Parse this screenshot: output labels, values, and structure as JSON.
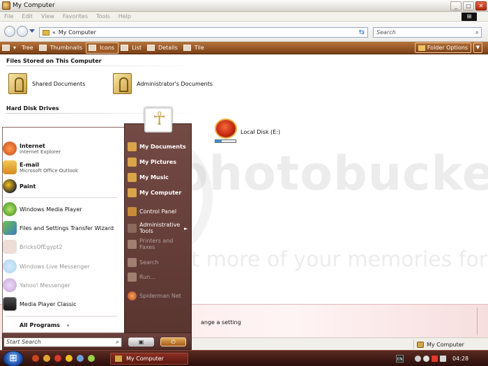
{
  "window": {
    "title": "My Computer",
    "controls": {
      "minimize": "_",
      "maximize": "□",
      "close": "✕"
    }
  },
  "menubar": {
    "items": [
      "File",
      "Edit",
      "View",
      "Favorites",
      "Tools",
      "Help"
    ]
  },
  "addressbar": {
    "chevron": "«",
    "path": "My Computer",
    "search_placeholder": "Search"
  },
  "toolbar": {
    "views": [
      "Tree",
      "Thumbnails",
      "Icons",
      "List",
      "Details",
      "Tile"
    ],
    "active_view": "Icons",
    "folder_options": "Folder Options"
  },
  "content": {
    "groups": [
      {
        "header": "Files Stored on This Computer",
        "items": [
          "Shared Documents",
          "Administrator's Documents"
        ]
      },
      {
        "header": "Hard Disk Drives",
        "items": [
          "Local Disk (E:)"
        ]
      }
    ],
    "drive_fill_percent": 30
  },
  "details_pane": {
    "text": "ange a setting"
  },
  "statusbar": {
    "location": "My Computer"
  },
  "start_menu": {
    "pinned": [
      {
        "name": "Internet",
        "sub": "Internet Explorer",
        "color": "#c8461c"
      },
      {
        "name": "E-mail",
        "sub": "Microsoft Office Outlook",
        "color": "#e0a72c"
      },
      {
        "name": "Paint",
        "sub": "",
        "color": "#2f2f2f"
      }
    ],
    "recent": [
      {
        "name": "Windows Media Player",
        "color": "#5aa12c",
        "faded": false
      },
      {
        "name": "Files and Settings Transfer Wizard",
        "color": "#3b7bc4",
        "faded": false
      },
      {
        "name": "BricksOfEgypt2",
        "color": "#b98a7a",
        "faded": true
      },
      {
        "name": "Windows Live Messenger",
        "color": "#4aa0d8",
        "faded": true
      },
      {
        "name": "Yahoo! Messenger",
        "color": "#7b3fa0",
        "faded": true
      },
      {
        "name": "Media Player Classic",
        "color": "#2a2a2a",
        "faded": false
      }
    ],
    "all_programs": "All Programs",
    "right_pane": [
      {
        "label": "My Documents",
        "bold": true,
        "faded": false
      },
      {
        "label": "My Pictures",
        "bold": true,
        "faded": false
      },
      {
        "label": "My Music",
        "bold": true,
        "faded": false
      },
      {
        "label": "My Computer",
        "bold": true,
        "faded": false
      },
      {
        "label": "Control Panel",
        "bold": false,
        "faded": false
      },
      {
        "label": "Administrative Tools",
        "bold": false,
        "faded": false
      },
      {
        "label": "Printers and Faxes",
        "bold": false,
        "faded": true
      },
      {
        "label": "Search",
        "bold": false,
        "faded": true
      },
      {
        "label": "Run...",
        "bold": false,
        "faded": true
      },
      {
        "label": "Spiderman Net",
        "bold": false,
        "faded": true
      }
    ],
    "search_placeholder": "Start Search"
  },
  "taskbar": {
    "task_label": "My Computer",
    "lang": "EN",
    "clock": "04:28"
  },
  "watermark": {
    "big": "photobucket",
    "small": "Protect more of your memories for less!"
  }
}
